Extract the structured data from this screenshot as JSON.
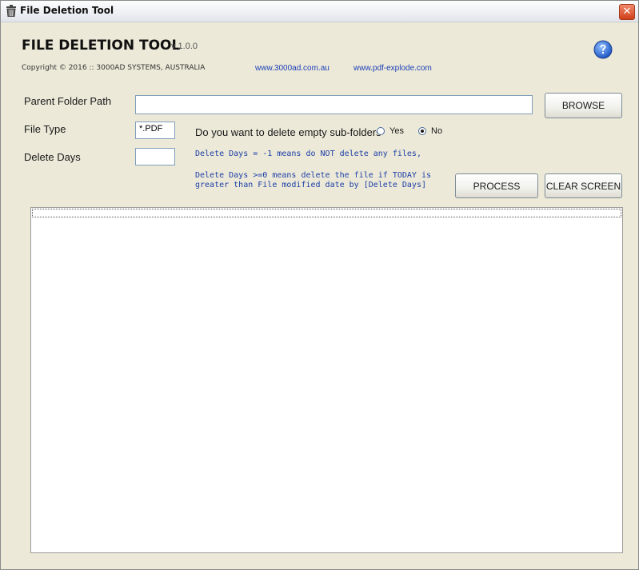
{
  "window": {
    "title": "File Deletion Tool",
    "close_glyph": "✕"
  },
  "header": {
    "app_title": "FILE DELETION TOOL",
    "version": "v 1.0.0",
    "copyright": "Copyright © 2016 :: 3000AD SYSTEMS, AUSTRALIA",
    "links": [
      "www.3000ad.com.au",
      "www.pdf-explode.com"
    ],
    "help_icon": "help-icon"
  },
  "form": {
    "parent_folder_label": "Parent Folder Path",
    "parent_folder_value": "",
    "file_type_label": "File Type",
    "file_type_value": "*.PDF",
    "delete_days_label": "Delete Days",
    "delete_days_value": "",
    "subfolder_question": "Do you want to delete empty sub-folders",
    "radio_yes": "Yes",
    "radio_no": "No",
    "selected_option": "No",
    "note1": "Delete Days = -1 means do NOT delete any files,",
    "note2_line1": "Delete Days >=0 means delete the file if TODAY is",
    "note2_line2": "greater than File modified date by [Delete Days]"
  },
  "buttons": {
    "browse": "BROWSE",
    "process": "PROCESS",
    "clear": "CLEAR SCREEN"
  },
  "output": {
    "lines": []
  },
  "colors": {
    "link": "#1b3fb8",
    "note": "#1d3fa6",
    "close": "#d2401a",
    "help": "#2a6ad2"
  }
}
